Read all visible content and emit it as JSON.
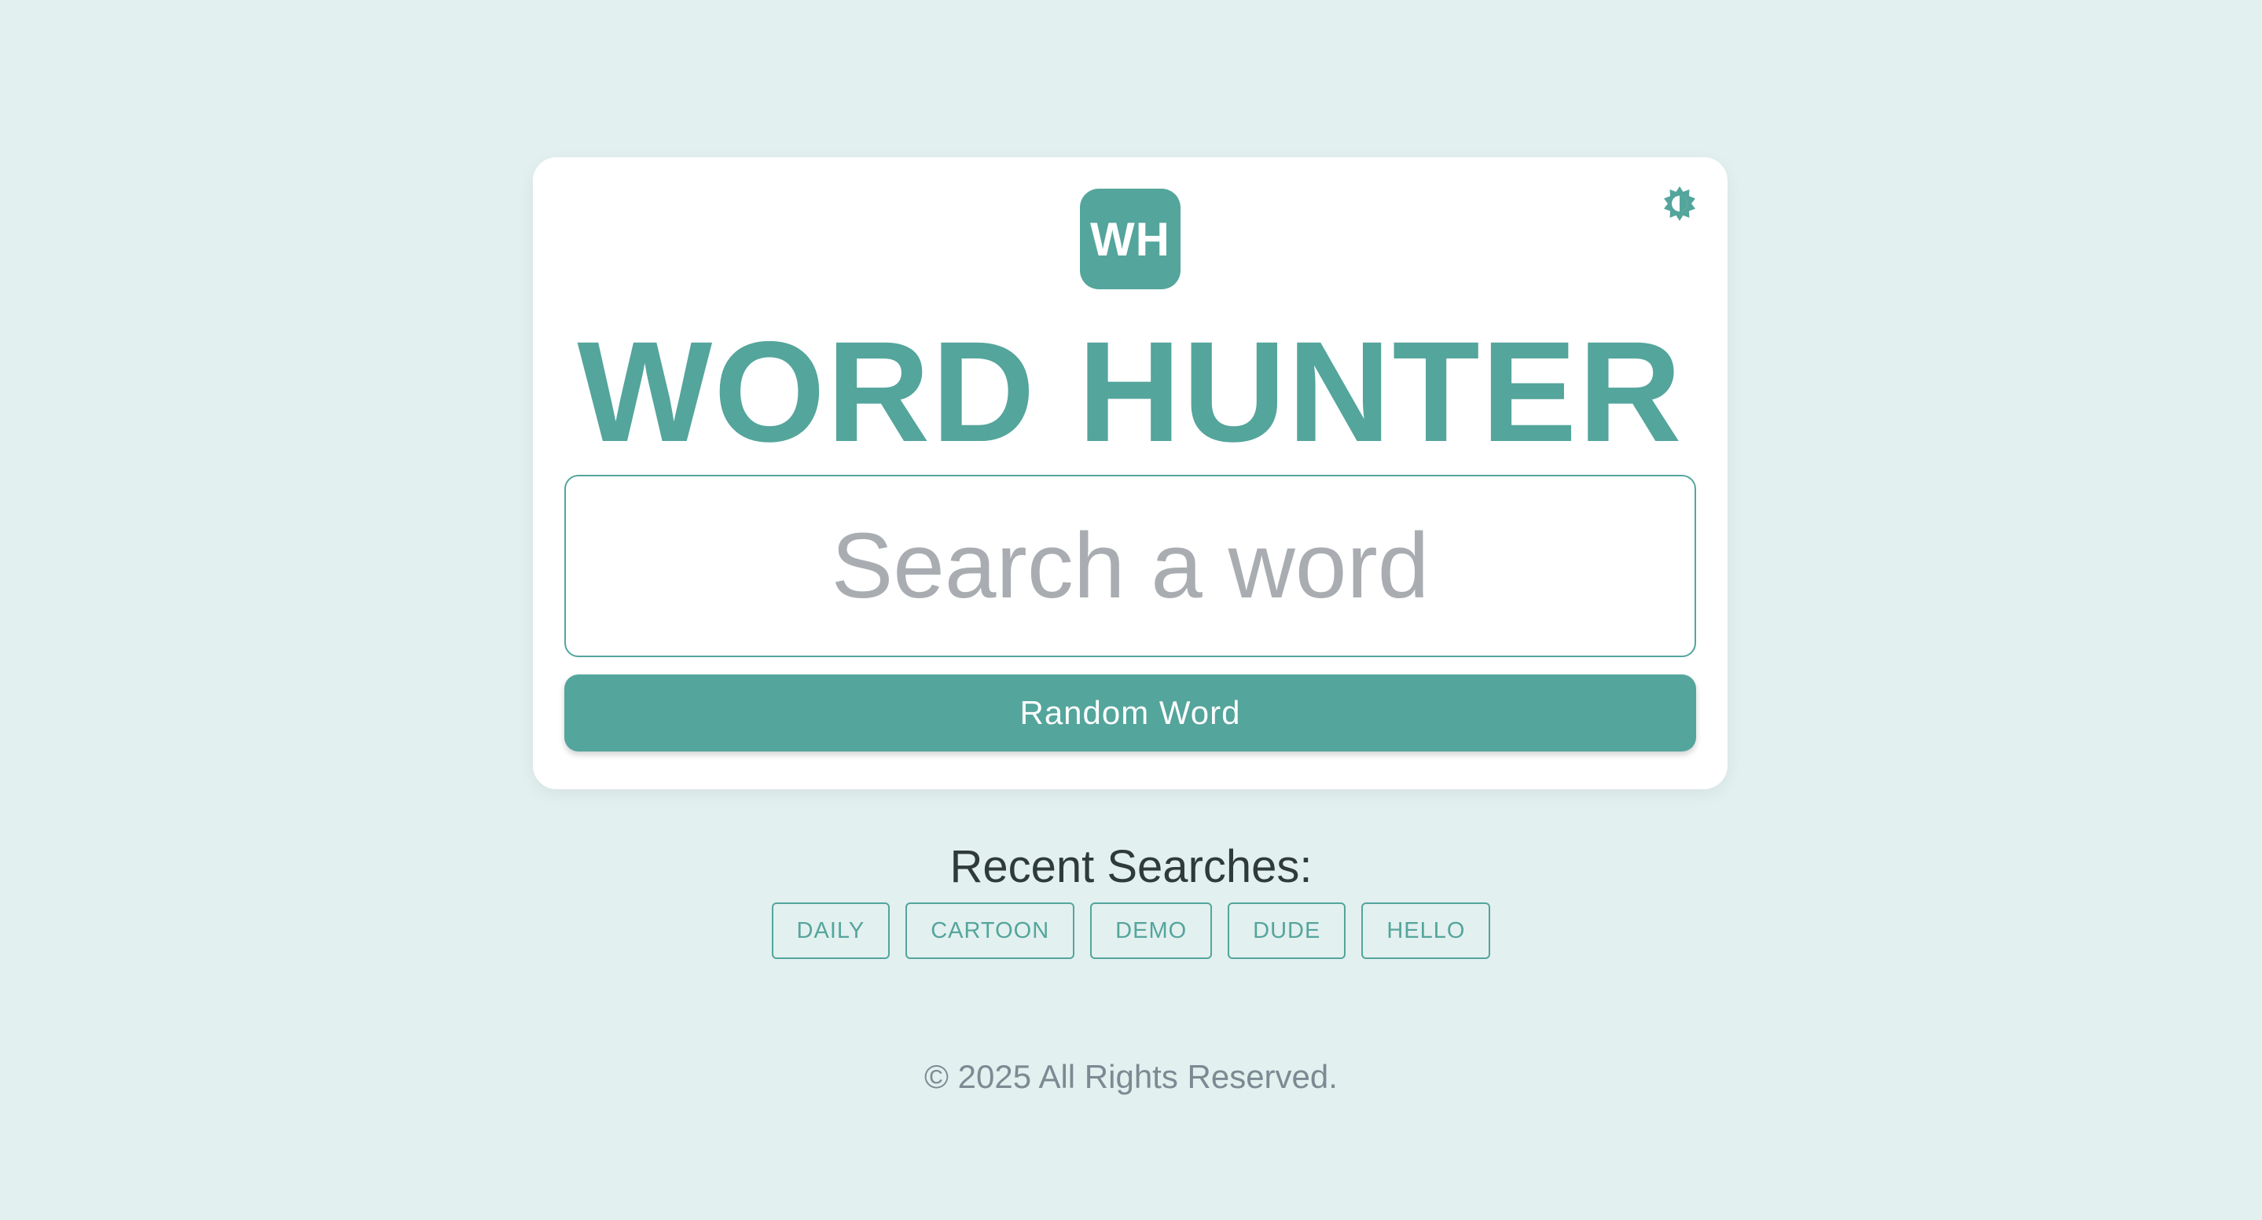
{
  "app": {
    "logo_text": "WH",
    "title": "WORD HUNTER",
    "theme_icon": "brightness-icon"
  },
  "search": {
    "placeholder": "Search a word",
    "value": ""
  },
  "random_button": {
    "label": "Random Word"
  },
  "recent": {
    "title": "Recent Searches:",
    "items": [
      "DAILY",
      "CARTOON",
      "DEMO",
      "DUDE",
      "HELLO"
    ]
  },
  "footer": {
    "text": "© 2025 All Rights Reserved."
  },
  "colors": {
    "accent": "#54a59c",
    "background": "#e2f0ef",
    "card": "#ffffff",
    "placeholder": "#a9adb1",
    "footer_text": "#7c8a93"
  }
}
